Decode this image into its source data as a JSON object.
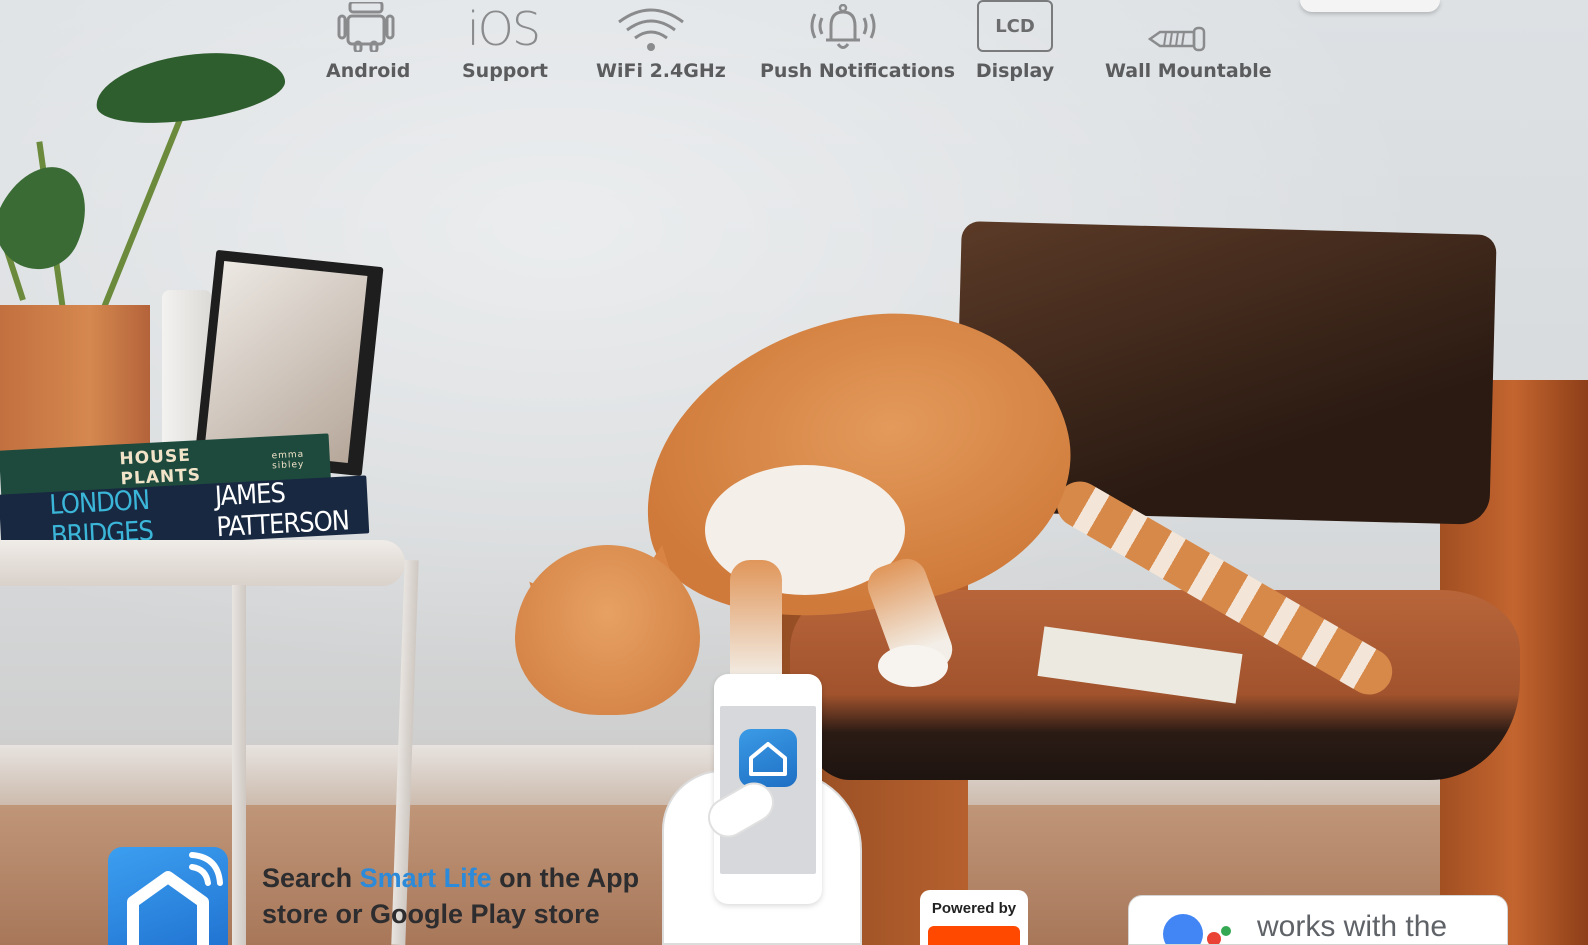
{
  "features": [
    {
      "icon": "android-icon",
      "label": "Android"
    },
    {
      "icon": "ios-icon",
      "icon_text": "iOS",
      "label": "Support"
    },
    {
      "icon": "wifi-icon",
      "label": "WiFi 2.4GHz"
    },
    {
      "icon": "bell-icon",
      "label": "Push Notifications"
    },
    {
      "icon": "lcd-icon",
      "icon_text": "LCD",
      "label": "Display"
    },
    {
      "icon": "screw-icon",
      "label": "Wall Mountable"
    }
  ],
  "scene": {
    "book_top_title": "HOUSE PLANTS",
    "book_top_author": "emma sibley",
    "book_bottom_title": "LONDON BRIDGES",
    "book_bottom_author": "JAMES PATTERSON"
  },
  "app_promo": {
    "text_prefix": "Search ",
    "app_name": "Smart Life",
    "text_suffix": " on the App store or Google Play store"
  },
  "powered_badge": {
    "label": "Powered by"
  },
  "assistant_badge": {
    "label": "works with the"
  },
  "colors": {
    "label_text": "#5b5c5e",
    "highlight_blue": "#2b8ad9",
    "app_blue": "#2174d2",
    "brand_orange": "#ff4800"
  }
}
